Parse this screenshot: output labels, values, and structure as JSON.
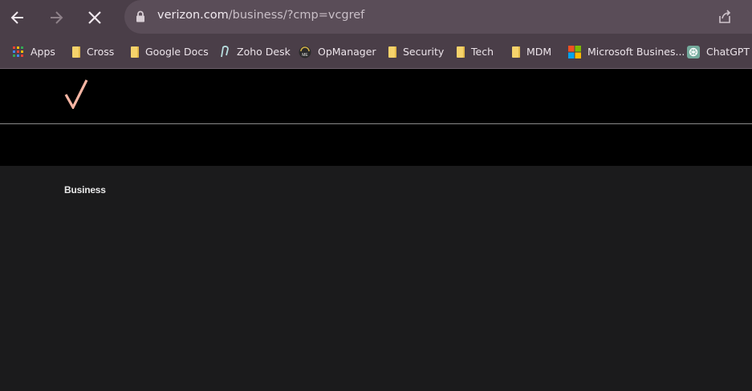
{
  "browser": {
    "url_domain": "verizon.com",
    "url_path": "/business/?cmp=vcgref",
    "icons": {
      "back": "arrow-left-icon",
      "forward": "arrow-right-icon",
      "stop": "close-icon",
      "lock": "lock-icon",
      "share": "share-icon"
    }
  },
  "bookmarks": [
    {
      "label": "Apps",
      "icon": "apps-grid-icon"
    },
    {
      "label": "Cross",
      "icon": "folder-icon"
    },
    {
      "label": "Google Docs",
      "icon": "folder-icon"
    },
    {
      "label": "Zoho Desk",
      "icon": "zoho-desk-icon"
    },
    {
      "label": "OpManager",
      "icon": "opmanager-icon"
    },
    {
      "label": "Security",
      "icon": "folder-icon"
    },
    {
      "label": "Tech",
      "icon": "folder-icon"
    },
    {
      "label": "MDM",
      "icon": "folder-icon"
    },
    {
      "label": "Microsoft Busines...",
      "icon": "microsoft-icon"
    },
    {
      "label": "ChatGPT",
      "icon": "chatgpt-icon"
    }
  ],
  "page": {
    "logo": "verizon-check-icon",
    "accent_color": "#f5b5a3",
    "nav_label": "Business"
  }
}
